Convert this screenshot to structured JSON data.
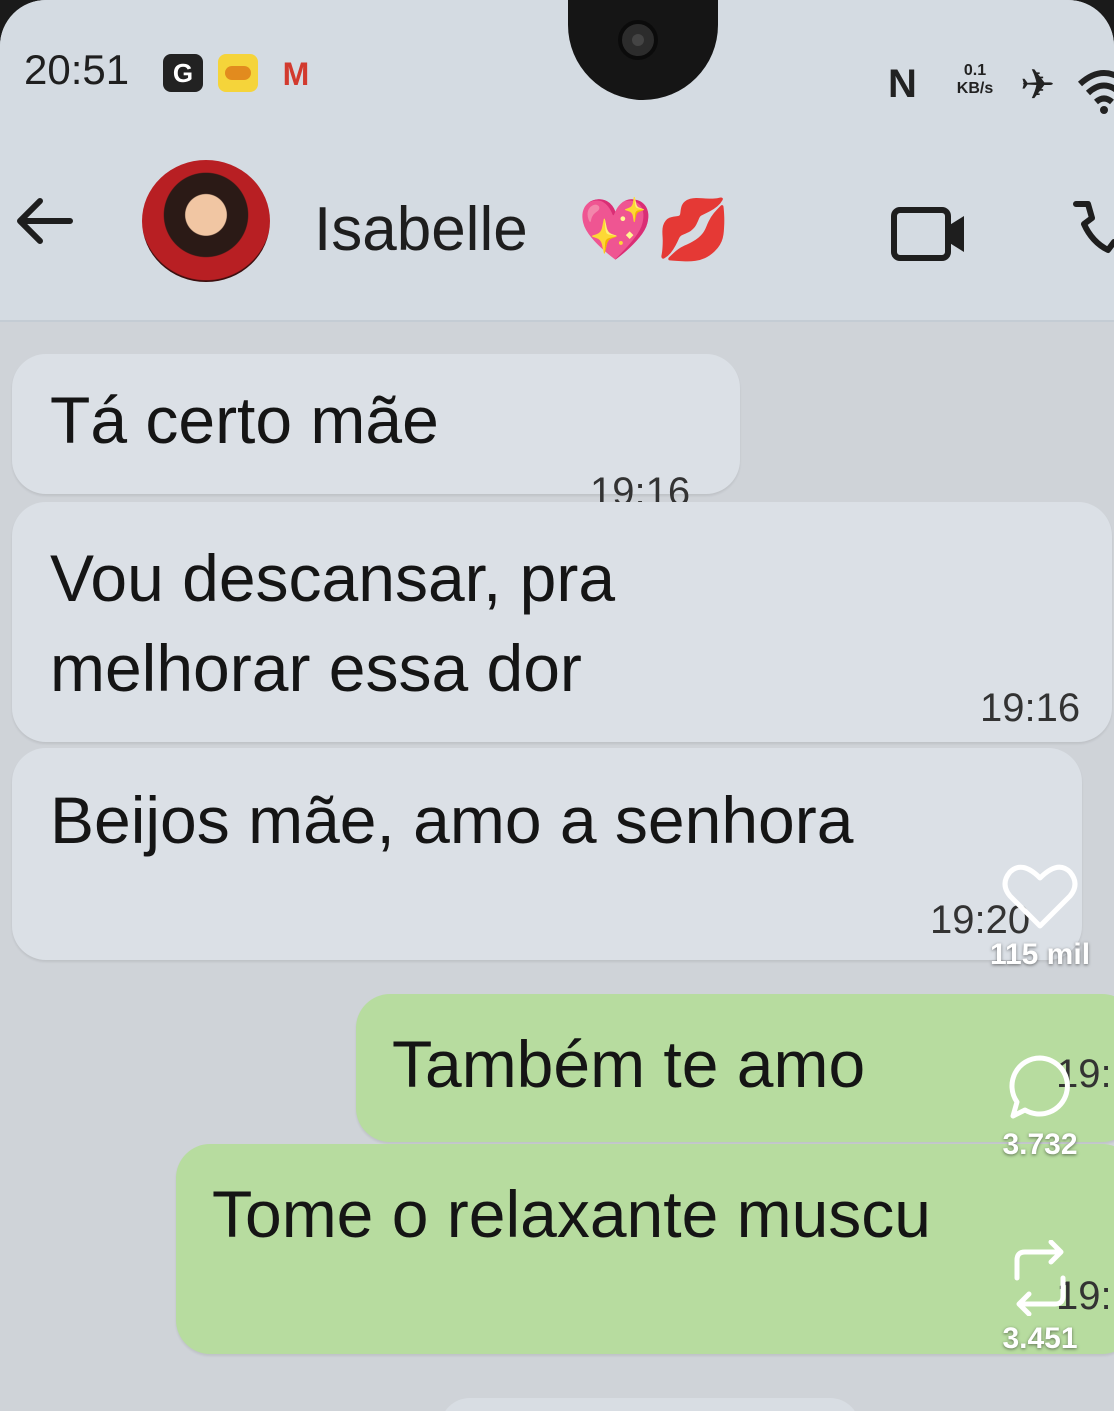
{
  "status_bar": {
    "time": "20:51",
    "notif_icons": [
      "g-icon",
      "app-icon",
      "gmail-icon"
    ],
    "nfc": "N",
    "speed_value": "0.1",
    "speed_unit": "KB/s"
  },
  "header": {
    "contact_name": "Isabelle",
    "emojis": [
      "💖",
      "💋"
    ]
  },
  "messages": [
    {
      "direction": "incoming",
      "text": "Tá certo mãe",
      "time": "19:16"
    },
    {
      "direction": "incoming",
      "text_line1": "Vou descansar, pra",
      "text_line2": "melhorar essa dor",
      "time": "19:16"
    },
    {
      "direction": "incoming",
      "text": "Beijos mãe, amo a senhora",
      "time": "19:20"
    },
    {
      "direction": "outgoing",
      "text": "Também te amo",
      "time": "19:"
    },
    {
      "direction": "outgoing",
      "text": "Tome o relaxante muscu",
      "time": "19:"
    }
  ],
  "overlay": {
    "likes": "115 mil",
    "comments": "3.732",
    "reposts": "3.451"
  },
  "colors": {
    "incoming_bubble": "#dbe0e6",
    "outgoing_bubble": "#b7dc9f",
    "header_bg": "#d4dbe2"
  }
}
